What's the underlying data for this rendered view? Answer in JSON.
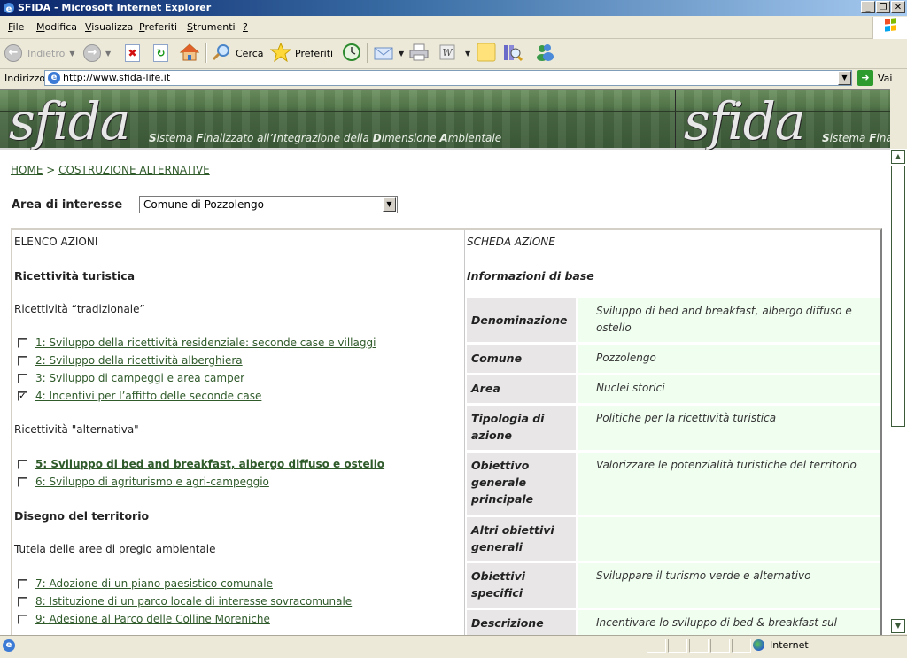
{
  "window": {
    "title": "SFIDA - Microsoft Internet Explorer",
    "buttons": [
      "_",
      "❐",
      "✕"
    ]
  },
  "menubar": {
    "items": [
      {
        "label": "File",
        "accel": "F"
      },
      {
        "label": "Modifica",
        "accel": "M"
      },
      {
        "label": "Visualizza",
        "accel": "V"
      },
      {
        "label": "Preferiti",
        "accel": "P"
      },
      {
        "label": "Strumenti",
        "accel": "S"
      },
      {
        "label": "?",
        "accel": "?"
      }
    ]
  },
  "toolbar": {
    "back_label": "Indietro",
    "search_label": "Cerca",
    "favorites_label": "Preferiti"
  },
  "addressbar": {
    "label": "Indirizzo",
    "url": "http://www.sfida-life.it",
    "go_label": "Vai"
  },
  "banner": {
    "logo": "sfida",
    "tagline_parts": [
      {
        "b": "S",
        "t": "istema "
      },
      {
        "b": "F",
        "t": "inalizzato all’"
      },
      {
        "b": "I",
        "t": "ntegrazione della "
      },
      {
        "b": "D",
        "t": "imensione "
      },
      {
        "b": "A",
        "t": "mbientale"
      }
    ]
  },
  "breadcrumb": {
    "home": "HOME",
    "separator": " > ",
    "current": "COSTRUZIONE ALTERNATIVE"
  },
  "area": {
    "label": "Area di interesse",
    "selected": "Comune di Pozzolengo"
  },
  "left": {
    "title": "ELENCO AZIONI",
    "sections": [
      {
        "heading": "Ricettività turistica"
      },
      {
        "subheading": "Ricettività “tradizionale”"
      },
      {
        "subheading2": "Ricettività \"alternativa\""
      },
      {
        "heading": "Disegno del territorio"
      },
      {
        "subheading": "Tutela delle aree di pregio ambientale"
      }
    ],
    "actions": [
      {
        "label": "1: Sviluppo della ricettività residenziale: seconde case e villaggi",
        "checked": false,
        "selected": false
      },
      {
        "label": "2: Sviluppo della ricettività alberghiera",
        "checked": false,
        "selected": false
      },
      {
        "label": "3: Sviluppo di campeggi e area camper",
        "checked": false,
        "selected": false
      },
      {
        "label": "4: Incentivi per l’affitto delle seconde case",
        "checked": true,
        "selected": false
      },
      {
        "label": "5: Sviluppo di bed and breakfast, albergo diffuso e ostello",
        "checked": false,
        "selected": true
      },
      {
        "label": "6: Sviluppo di agriturismo e agri-campeggio",
        "checked": false,
        "selected": false
      },
      {
        "label": "7: Adozione di un piano paesistico comunale",
        "checked": false,
        "selected": false
      },
      {
        "label": "8: Istituzione di un parco locale di interesse sovracomunale",
        "checked": false,
        "selected": false
      },
      {
        "label": "9: Adesione al Parco delle Colline Moreniche",
        "checked": false,
        "selected": false
      }
    ]
  },
  "right": {
    "title": "SCHEDA AZIONE",
    "subtitle": "Informazioni di base",
    "rows": [
      {
        "key": "Denominazione",
        "value": "Sviluppo di bed and breakfast, albergo diffuso e ostello"
      },
      {
        "key": "Comune",
        "value": "Pozzolengo"
      },
      {
        "key": "Area",
        "value": "Nuclei storici"
      },
      {
        "key": "Tipologia di azione",
        "value": "Politiche per la ricettività turistica"
      },
      {
        "key": "Obiettivo generale principale",
        "value": "Valorizzare le potenzialità turistiche del territorio"
      },
      {
        "key": "Altri obiettivi generali",
        "value": "---"
      },
      {
        "key": "Obiettivi specifici",
        "value": "Sviluppare il turismo verde e alternativo"
      },
      {
        "key": "Descrizione",
        "value": "Incentivare lo sviluppo di bed & breakfast sul"
      }
    ]
  },
  "statusbar": {
    "zone": "Internet"
  },
  "colors": {
    "link": "#2f5a2a",
    "info_key_bg": "#e8e6e6",
    "info_val_bg": "#f0fef0",
    "banner_green": "#4a6b41"
  }
}
